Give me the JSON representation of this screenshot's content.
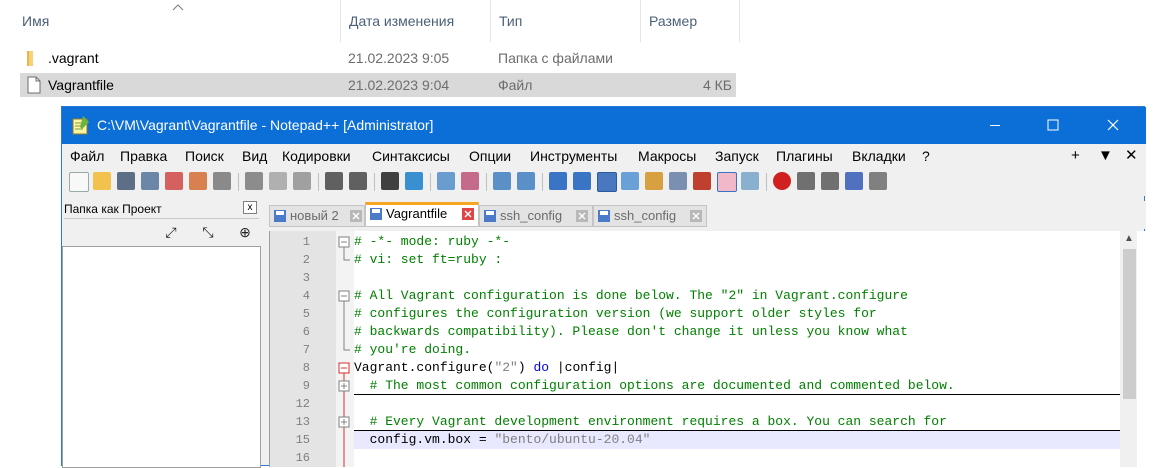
{
  "explorer": {
    "columns": {
      "name": "Имя",
      "date": "Дата изменения",
      "type": "Тип",
      "size": "Размер"
    },
    "rows": [
      {
        "name": ".vagrant",
        "date": "21.02.2023 9:05",
        "type": "Папка с файлами",
        "size": "",
        "icon": "folder-icon"
      },
      {
        "name": "Vagrantfile",
        "date": "21.02.2023 9:04",
        "type": "Файл",
        "size": "4 КБ",
        "icon": "file-icon"
      }
    ]
  },
  "window": {
    "title": "C:\\VM\\Vagrant\\Vagrantfile - Notepad++ [Administrator]",
    "menu": [
      "Файл",
      "Правка",
      "Поиск",
      "Вид",
      "Кодировки",
      "Синтаксисы",
      "Опции",
      "Инструменты",
      "Макросы",
      "Запуск",
      "Плагины",
      "Вкладки",
      "?"
    ],
    "menu_right": [
      "+",
      "▼",
      "✕"
    ]
  },
  "panel": {
    "title": "Папка как Проект",
    "close": "x"
  },
  "tabs": [
    {
      "label": "новый 2",
      "active": false
    },
    {
      "label": "Vagrantfile",
      "active": true
    },
    {
      "label": "ssh_config",
      "active": false
    },
    {
      "label": "ssh_config",
      "active": false
    }
  ],
  "editor": {
    "lines": [
      {
        "num": "1",
        "text": "# -*- mode: ruby -*-"
      },
      {
        "num": "2",
        "text": "# vi: set ft=ruby :"
      },
      {
        "num": "3",
        "text": ""
      },
      {
        "num": "4",
        "text": "# All Vagrant configuration is done below. The \"2\" in Vagrant.configure"
      },
      {
        "num": "5",
        "text": "# configures the configuration version (we support older styles for"
      },
      {
        "num": "6",
        "text": "# backwards compatibility). Please don't change it unless you know what"
      },
      {
        "num": "7",
        "text": "# you're doing."
      },
      {
        "num": "8",
        "text": "Vagrant.configure(\"2\") do |config|"
      },
      {
        "num": "9",
        "text": "  # The most common configuration options are documented and commented below."
      },
      {
        "num": "12",
        "text": ""
      },
      {
        "num": "13",
        "text": "  # Every Vagrant development environment requires a box. You can search for"
      },
      {
        "num": "15",
        "text": "  config.vm.box = \"bento/ubuntu-20.04\""
      },
      {
        "num": "16",
        "text": ""
      }
    ]
  },
  "colors": {
    "titlebar": "#0c6fd8",
    "comment": "#008000",
    "keyword": "#0000ff",
    "string": "#808080",
    "active_tab_accent": "#f5a623",
    "fold_marker": "#d32f2f",
    "current_line": "#e8e8ff"
  }
}
